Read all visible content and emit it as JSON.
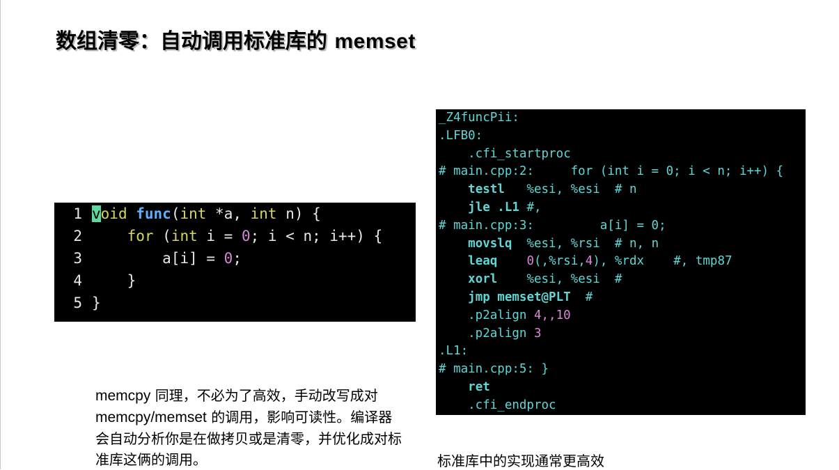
{
  "slide": {
    "title_cn": "数组清零：自动调用标准库的",
    "title_code": "memset"
  },
  "source_code": {
    "lines": [
      {
        "num": "1",
        "cursor": "v",
        "a": "oid ",
        "fn": "func",
        "b": "(",
        "kw1": "int",
        "c": " *a, ",
        "kw2": "int",
        "d": " n) {"
      },
      {
        "num": "2",
        "indent": "    ",
        "kw": "for",
        "a": " (",
        "kw2": "int",
        "b": " i = ",
        "n": "0",
        "c": "; i < n; i++) {"
      },
      {
        "num": "3",
        "indent": "        ",
        "a": "a[i] = ",
        "n": "0",
        "b": ";"
      },
      {
        "num": "4",
        "indent": "    ",
        "a": "}"
      },
      {
        "num": "5",
        "indent": "",
        "a": "}"
      }
    ]
  },
  "assembly": {
    "l1": "_Z4funcPii:",
    "l2": ".LFB0:",
    "l3": "    .cfi_startproc",
    "l4": "# main.cpp:2:     for (int i = 0; i < n; i++) {",
    "l5_op": "testl",
    "l5_a": "   %esi, %esi",
    "l5_c": "  # n",
    "l6_op": "jle .L1",
    "l6_c": " #,",
    "l7": "# main.cpp:3:         a[i] = 0;",
    "l8_op": "movslq",
    "l8_a": "  %esi, %rsi",
    "l8_c": "  # n, n",
    "l9_op": "leaq",
    "l9_n": "0",
    "l9_a": "(,%rsi,",
    "l9_n2": "4",
    "l9_b": "), %rdx",
    "l9_c": "    #, tmp87",
    "l10_op": "xorl",
    "l10_a": "    %esi, %esi",
    "l10_c": "  #",
    "l11_op": "jmp memset@PLT",
    "l11_c": "  #",
    "l12_a": "    .p2align ",
    "l12_n": "4,,10",
    "l13_a": "    .p2align ",
    "l13_n": "3",
    "l14": ".L1:",
    "l15": "# main.cpp:5: }",
    "l16_op": "ret",
    "l17": "    .cfi_endproc",
    "l18": "    _"
  },
  "notes": {
    "p_en1": "memcpy",
    "p_cn1": " 同理，不必为了高效，手动改写成对 ",
    "p_en2": "memcpy/memset",
    "p_cn2": " 的调用，影响可读性。编译器会自动分析你是在做拷贝或是清零，并优化成对标准库这俩的调用。"
  },
  "caption": "标准库中的实现通常更高效"
}
